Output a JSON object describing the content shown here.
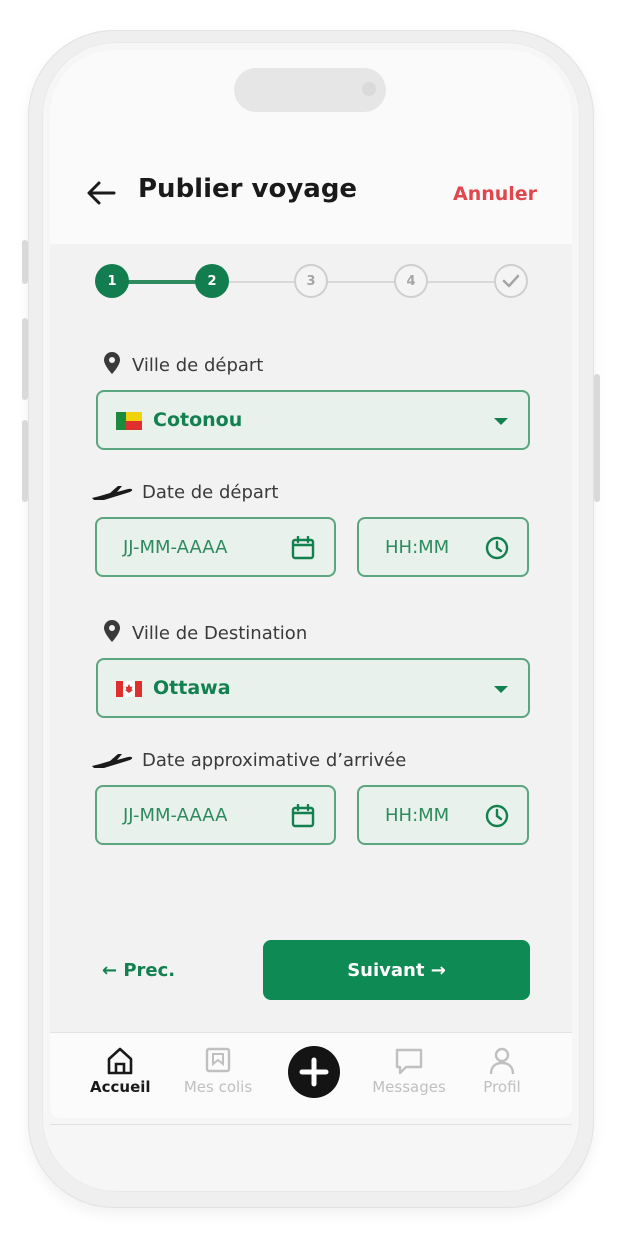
{
  "header": {
    "title": "Publier voyage",
    "cancel_label": "Annuler"
  },
  "stepper": {
    "steps": [
      "1",
      "2",
      "3",
      "4"
    ],
    "current_step": 2
  },
  "form": {
    "departure_city": {
      "label": "Ville de départ",
      "value": "Cotonou",
      "flag": "benin-flag-icon"
    },
    "departure_date": {
      "label": "Date de départ",
      "date_placeholder": "JJ-MM-AAAA",
      "time_placeholder": "HH:MM"
    },
    "destination_city": {
      "label": "Ville de Destination",
      "value": "Ottawa",
      "flag": "canada-flag-icon"
    },
    "arrival_date": {
      "label": "Date approximative d’arrivée",
      "date_placeholder": "JJ-MM-AAAA",
      "time_placeholder": "HH:MM"
    }
  },
  "actions": {
    "prev_label": "← Prec.",
    "next_label": "Suivant →"
  },
  "tabbar": {
    "items": [
      {
        "label": "Accueil",
        "icon": "home-icon",
        "active": true
      },
      {
        "label": "Mes colis",
        "icon": "package-icon",
        "active": false
      },
      {
        "label": "",
        "icon": "plus-icon",
        "active": false
      },
      {
        "label": "Messages",
        "icon": "message-icon",
        "active": false
      },
      {
        "label": "Profil",
        "icon": "user-icon",
        "active": false
      }
    ]
  },
  "colors": {
    "primary": "#0e8a55",
    "accent_red": "#e0464b",
    "field_bg": "#e8f1ec",
    "field_border": "#5ba57f"
  }
}
